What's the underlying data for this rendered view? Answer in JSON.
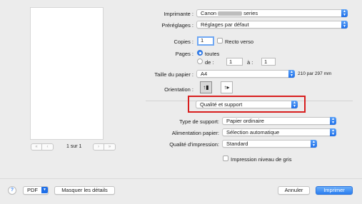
{
  "preview": {
    "page_count": "1 sur 1",
    "first_label": "«",
    "prev_label": "‹",
    "next_label": "›",
    "last_label": "»"
  },
  "printer": {
    "label": "Imprimante :",
    "value_prefix": "Canon",
    "value_suffix": "series"
  },
  "presets": {
    "label": "Préréglages :",
    "value": "Réglages par défaut"
  },
  "copies": {
    "label": "Copies :",
    "value": "1",
    "duplex_label": "Recto verso"
  },
  "pages": {
    "label": "Pages :",
    "all_label": "toutes",
    "from_label": "de :",
    "from_value": "1",
    "to_label": "à :",
    "to_value": "1"
  },
  "paper_size": {
    "label": "Taille du papier :",
    "value": "A4",
    "dimensions": "210 par 297 mm"
  },
  "orientation": {
    "label": "Orientation :"
  },
  "section_popup": {
    "value": "Qualité et support"
  },
  "media_type": {
    "label": "Type de support:",
    "value": "Papier ordinaire"
  },
  "paper_source": {
    "label": "Alimentation papier:",
    "value": "Sélection automatique"
  },
  "print_quality": {
    "label": "Qualité d'impression:",
    "value": "Standard"
  },
  "grayscale": {
    "label": "Impression niveau de gris"
  },
  "footer": {
    "help_label": "?",
    "pdf_label": "PDF",
    "details_label": "Masquer les détails",
    "cancel_label": "Annuler",
    "print_label": "Imprimer"
  },
  "colors": {
    "accent": "#2b7ff0",
    "highlight_box": "#d81e1e"
  }
}
